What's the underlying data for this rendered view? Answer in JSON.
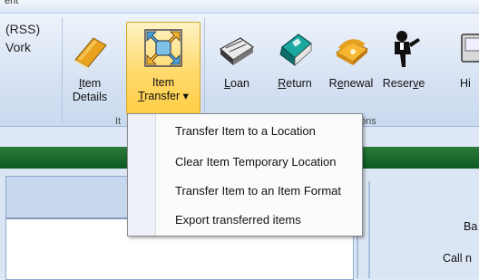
{
  "tabstrip": {
    "partial_text": "ent"
  },
  "left_column": {
    "line1": "(RSS)",
    "line2": "Vork"
  },
  "ribbon": {
    "item_details": {
      "line1": "Item",
      "line2": "Details",
      "accel1": "I",
      "rest1": "tem"
    },
    "item_transfer": {
      "line1": "Item",
      "accel2": "T",
      "rest2": "ransfer",
      "arrow": "▾"
    },
    "loan": {
      "accel": "L",
      "rest": "oan"
    },
    "return": {
      "accel": "R",
      "rest": "eturn"
    },
    "renewal": {
      "pre": "R",
      "accel": "e",
      "rest": "newal"
    },
    "reserve": {
      "pre": "Reser",
      "accel": "v",
      "rest": "e"
    },
    "partial": {
      "label": "Hi"
    },
    "group_label_left": "It",
    "group_label_right": "ons"
  },
  "menu": {
    "items": [
      "Transfer Item to a Location",
      "Clear Item Temporary Location",
      "Transfer Item to an Item Format",
      "Export transferred items"
    ]
  },
  "right_labels": {
    "label1": "Ba",
    "label2": "Call n"
  },
  "colors": {
    "band": "#0d5a22",
    "highlight": "#ffd96b"
  }
}
